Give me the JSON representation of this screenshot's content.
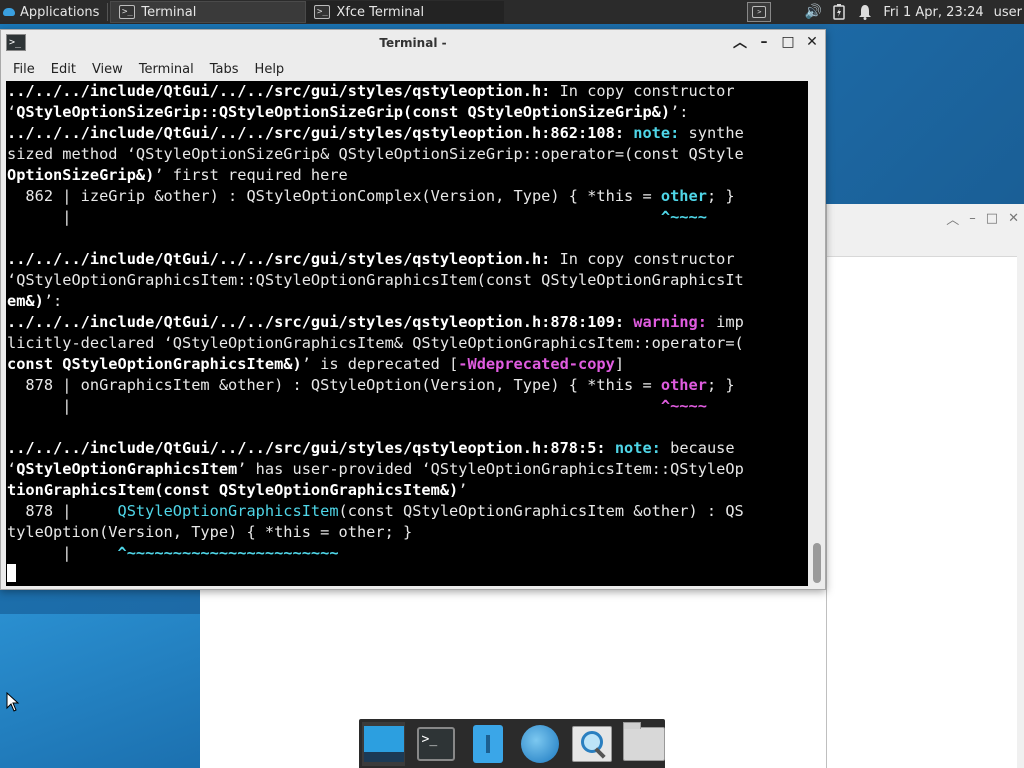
{
  "top_panel": {
    "applications_label": "Applications",
    "tasks": [
      {
        "label": "Terminal",
        "icon": "terminal-icon"
      },
      {
        "label": "Xfce Terminal",
        "icon": "terminal-icon"
      }
    ],
    "clock": "Fri 1 Apr, 23:24",
    "user": "user"
  },
  "terminal": {
    "title": "Terminal -",
    "menu": [
      "File",
      "Edit",
      "View",
      "Terminal",
      "Tabs",
      "Help"
    ],
    "lines": [
      "../../../include/QtGui/../../src/gui/styles/qstyleoption.h: In copy constructor",
      "‘QStyleOptionSizeGrip::QStyleOptionSizeGrip(const QStyleOptionSizeGrip&)’:",
      "../../../include/QtGui/../../src/gui/styles/qstyleoption.h:862:108: note: synthe",
      "sized method ‘QStyleOptionSizeGrip& QStyleOptionSizeGrip::operator=(const QStyle",
      "OptionSizeGrip&)’ first required here",
      "  862 | izeGrip &other) : QStyleOptionComplex(Version, Type) { *this = other; }",
      "      |                                                                ^~~~~",
      "",
      "../../../include/QtGui/../../src/gui/styles/qstyleoption.h: In copy constructor",
      "‘QStyleOptionGraphicsItem::QStyleOptionGraphicsItem(const QStyleOptionGraphicsIt",
      "em&)’:",
      "../../../include/QtGui/../../src/gui/styles/qstyleoption.h:878:109: warning: imp",
      "licitly-declared ‘QStyleOptionGraphicsItem& QStyleOptionGraphicsItem::operator=(",
      "const QStyleOptionGraphicsItem&)’ is deprecated [-Wdeprecated-copy]",
      "  878 | onGraphicsItem &other) : QStyleOption(Version, Type) { *this = other; }",
      "      |                                                                ^~~~~",
      "",
      "../../../include/QtGui/../../src/gui/styles/qstyleoption.h:878:5: note: because",
      "‘QStyleOptionGraphicsItem’ has user-provided ‘QStyleOptionGraphicsItem::QStyleOp",
      "tionGraphicsItem(const QStyleOptionGraphicsItem&)’",
      "  878 |     QStyleOptionGraphicsItem(const QStyleOptionGraphicsItem &other) : QS",
      "tyleOption(Version, Type) { *this = other; }",
      "      |     ^~~~~~~~~~~~~~~~~~~~~~~~",
      ""
    ]
  },
  "dock": {
    "items": [
      "desktop",
      "terminal",
      "files",
      "browser",
      "search",
      "folder"
    ]
  }
}
